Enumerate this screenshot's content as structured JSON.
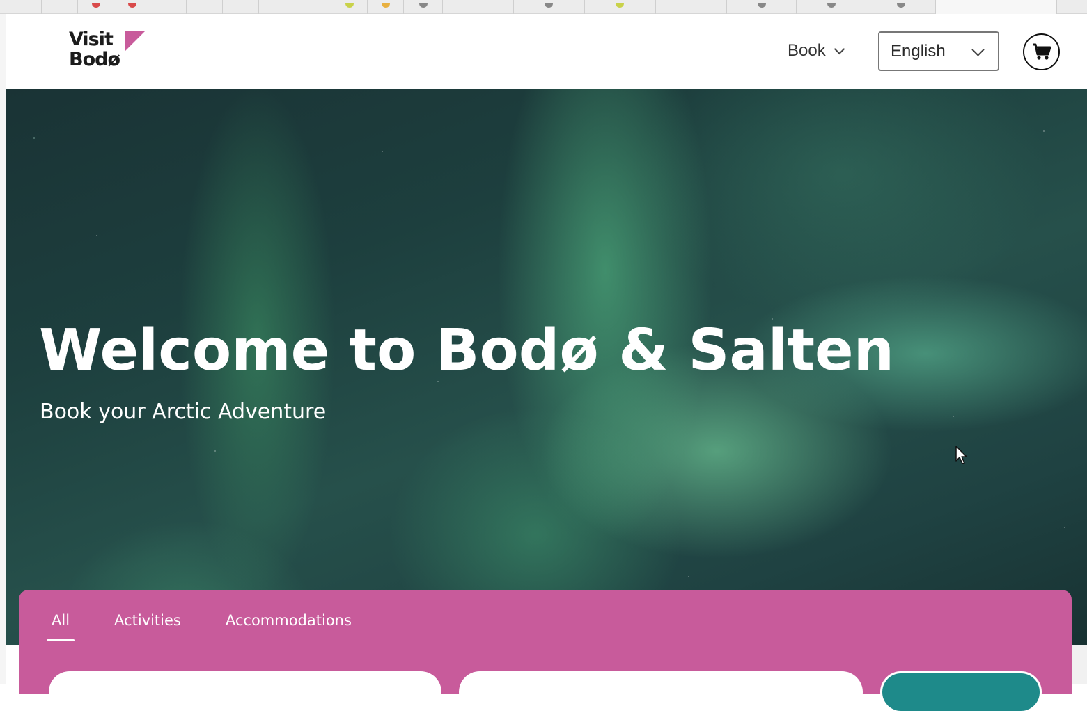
{
  "header": {
    "logo_line1": "Visit",
    "logo_line2": "Bodø",
    "book_label": "Book",
    "language": "English",
    "cart_icon": "cart-icon"
  },
  "hero": {
    "title": "Welcome to Bodø & Salten",
    "subtitle": "Book your Arctic Adventure"
  },
  "booking": {
    "tabs": [
      {
        "label": "All",
        "active": true
      },
      {
        "label": "Activities",
        "active": false
      },
      {
        "label": "Accommodations",
        "active": false
      }
    ]
  },
  "colors": {
    "accent_pink": "#c85b9b",
    "search_teal": "#1e8a8a"
  }
}
